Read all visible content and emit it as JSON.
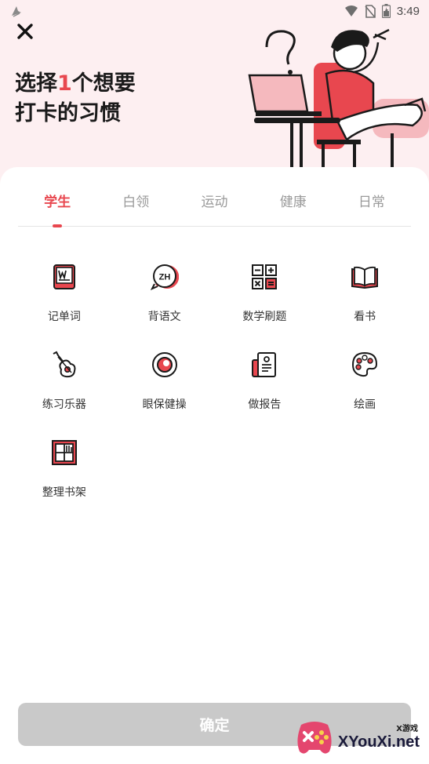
{
  "status_bar": {
    "time": "3:49",
    "icons": [
      "notification-icon",
      "wifi-icon",
      "no-sim-icon",
      "battery-icon"
    ]
  },
  "header": {
    "title_part1": "选择",
    "title_accent": "1",
    "title_part2": "个想要",
    "title_line2": "打卡的习惯"
  },
  "tabs": [
    {
      "label": "学生",
      "active": true
    },
    {
      "label": "白领",
      "active": false
    },
    {
      "label": "运动",
      "active": false
    },
    {
      "label": "健康",
      "active": false
    },
    {
      "label": "日常",
      "active": false
    }
  ],
  "habits": [
    {
      "label": "记单词",
      "icon": "word-book-icon"
    },
    {
      "label": "背语文",
      "icon": "zh-speech-bubble-icon"
    },
    {
      "label": "数学刷题",
      "icon": "calculator-icon"
    },
    {
      "label": "看书",
      "icon": "open-book-icon"
    },
    {
      "label": "练习乐器",
      "icon": "guitar-icon"
    },
    {
      "label": "眼保健操",
      "icon": "eye-icon"
    },
    {
      "label": "做报告",
      "icon": "report-icon"
    },
    {
      "label": "绘画",
      "icon": "palette-icon"
    },
    {
      "label": "整理书架",
      "icon": "bookshelf-icon"
    }
  ],
  "confirm_label": "确定",
  "watermark": {
    "tag": "X游戏",
    "brand": "XYouXi.net"
  },
  "colors": {
    "accent": "#e8474f",
    "header_bg": "#fdeff1",
    "disabled_button": "#c9c9c9"
  }
}
